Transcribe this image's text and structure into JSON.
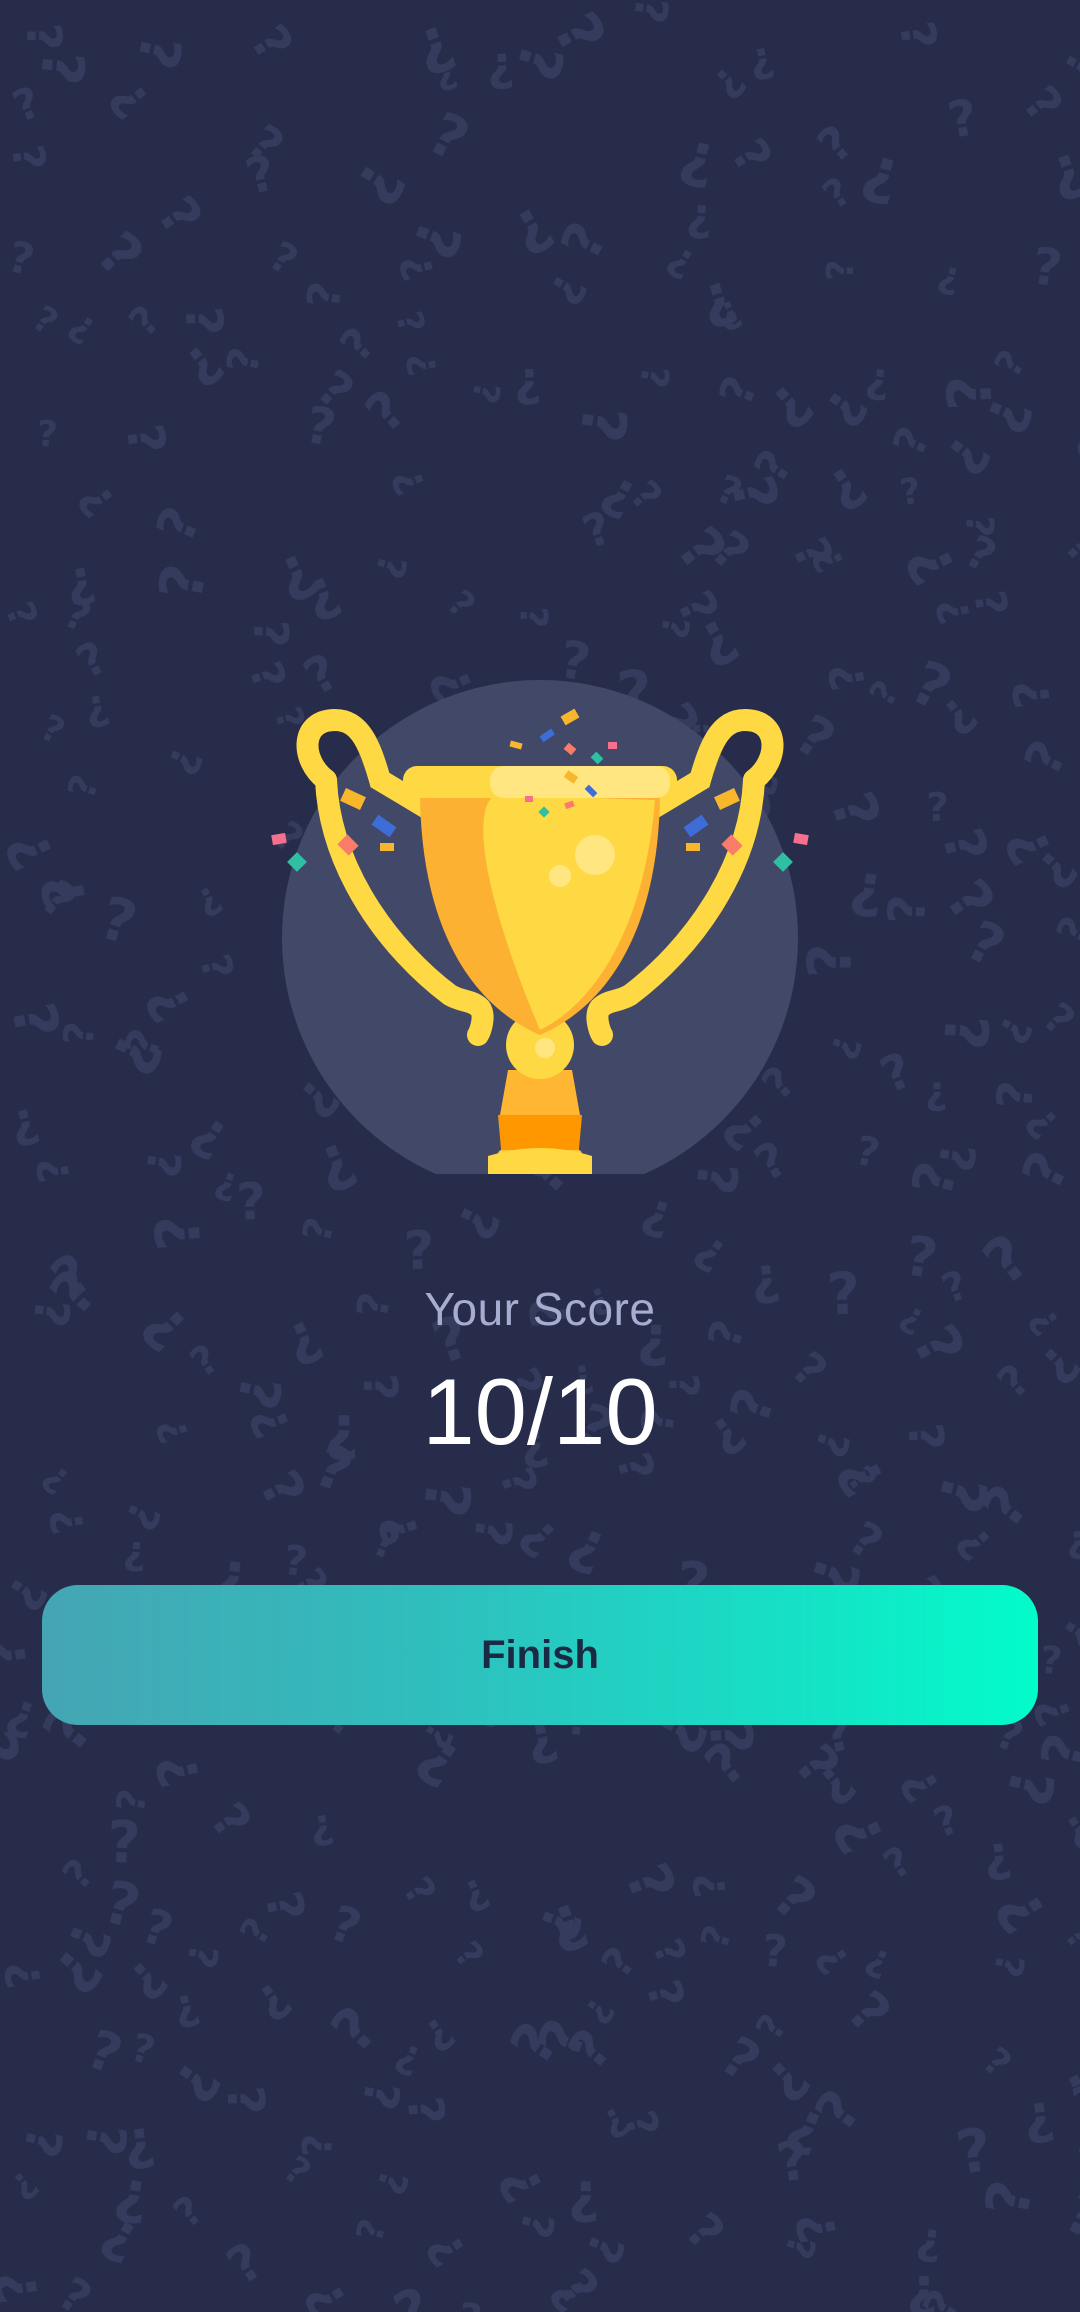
{
  "result": {
    "score_label": "Your Score",
    "score_value": "10/10"
  },
  "actions": {
    "finish_label": "Finish"
  },
  "icons": {
    "trophy": "trophy-icon",
    "background": "question-mark-pattern"
  },
  "colors": {
    "background": "#262c4a",
    "pattern_mark": "#353b5c",
    "trophy_circle": "#424868",
    "gold_light": "#ffd944",
    "gold_dark": "#fdb132",
    "gold_base": "#ff9800",
    "button_start": "#45a5b3",
    "button_end": "#02fcca",
    "button_text": "#1b2a44",
    "score_label": "#a8acd0",
    "score_value": "#ffffff"
  }
}
